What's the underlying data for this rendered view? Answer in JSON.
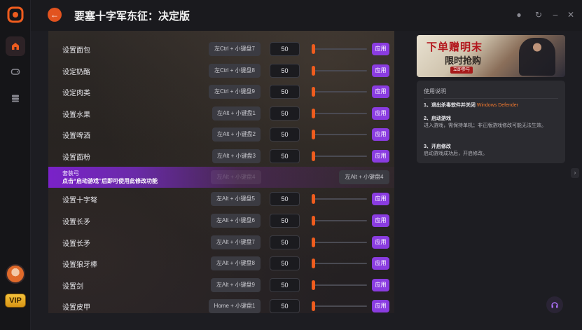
{
  "app": {
    "title": "要塞十字军东征：决定版",
    "vip_label": "VIP"
  },
  "sidebar": {
    "items": [
      {
        "icon": "home-icon"
      },
      {
        "icon": "gamepad-icon"
      },
      {
        "icon": "stack-icon"
      }
    ]
  },
  "rows": [
    {
      "label": "设置面包",
      "hotkey": "左Ctrl + 小键盘7",
      "value": "50",
      "apply": "应用"
    },
    {
      "label": "设定奶酪",
      "hotkey": "左Ctrl + 小键盘8",
      "value": "50",
      "apply": "应用"
    },
    {
      "label": "设定肉类",
      "hotkey": "左Ctrl + 小键盘9",
      "value": "50",
      "apply": "应用"
    },
    {
      "label": "设置水果",
      "hotkey": "左Alt + 小键盘1",
      "value": "50",
      "apply": "应用"
    },
    {
      "label": "设置啤酒",
      "hotkey": "左Alt + 小键盘2",
      "value": "50",
      "apply": "应用"
    },
    {
      "label": "设置面粉",
      "hotkey": "左Alt + 小键盘3",
      "value": "50",
      "apply": "应用"
    }
  ],
  "banner": {
    "line1": "套装弓",
    "line2": "点击“启动游戏”后即可使用此修改功能",
    "faded_hotkey": "左Alt + 小键盘4",
    "hotkey": "左Alt + 小键盘4"
  },
  "rows2": [
    {
      "label": "设置十字弩",
      "hotkey": "左Alt + 小键盘5",
      "value": "50",
      "apply": "应用"
    },
    {
      "label": "设置长矛",
      "hotkey": "左Alt + 小键盘6",
      "value": "50",
      "apply": "应用"
    },
    {
      "label": "设置长矛",
      "hotkey": "左Alt + 小键盘7",
      "value": "50",
      "apply": "应用"
    },
    {
      "label": "设置狼牙棒",
      "hotkey": "左Alt + 小键盘8",
      "value": "50",
      "apply": "应用"
    },
    {
      "label": "设置剑",
      "hotkey": "左Alt + 小键盘9",
      "value": "50",
      "apply": "应用"
    },
    {
      "label": "设置皮甲",
      "hotkey": "Home + 小键盘1",
      "value": "50",
      "apply": "应用"
    }
  ],
  "ad": {
    "title": "下单赠明末",
    "subtitle": "限时抢购",
    "button": "立即参与"
  },
  "help": {
    "title": "使用说明",
    "step1_title": "1、退出杀毒软件并关闭",
    "step1_highlight": "Windows Defender",
    "step2_title": "2、启动游戏",
    "step2_desc": "进入游戏，需保持单机；非正版游戏修改可能无法生效。",
    "step3_title": "3、开启修改",
    "step3_desc": "启动游戏成功后，开启修改。"
  },
  "colors": {
    "accent": "#ee5c1e",
    "apply": "#8a3ce0",
    "banner": "#7a22c9"
  }
}
